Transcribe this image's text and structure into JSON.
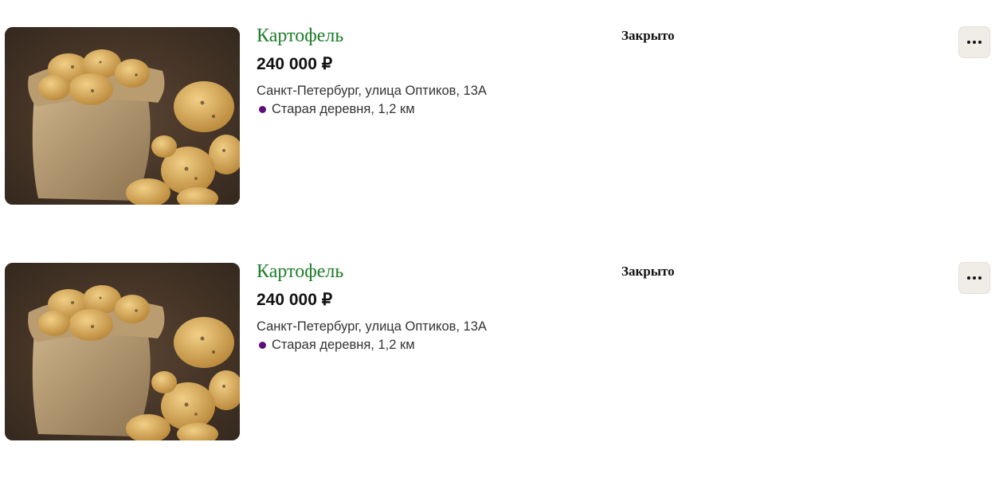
{
  "listings": [
    {
      "title": "Картофель",
      "price": "240 000 ₽",
      "address": "Санкт-Петербург, улица Оптиков, 13А",
      "metro": "Старая деревня, 1,2 км",
      "status": "Закрыто"
    },
    {
      "title": "Картофель",
      "price": "240 000 ₽",
      "address": "Санкт-Петербург, улица Оптиков, 13А",
      "metro": "Старая деревня, 1,2 км",
      "status": "Закрыто"
    }
  ],
  "colors": {
    "title": "#1e7d2a",
    "metro_line": "#5a1078",
    "more_button_bg": "#efede6"
  },
  "icons": {
    "more": "more-horizontal-icon",
    "metro": "metro-line-dot-icon"
  }
}
